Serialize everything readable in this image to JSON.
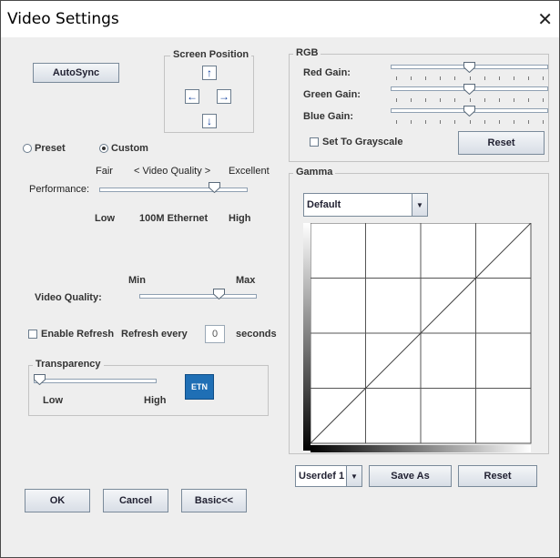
{
  "window": {
    "title": "Video Settings",
    "close_glyph": "✕"
  },
  "autosync_label": "AutoSync",
  "screen_position": {
    "title": "Screen Position",
    "up_icon": "arrow-up-icon",
    "left_icon": "arrow-left-icon",
    "right_icon": "arrow-right-icon",
    "down_icon": "arrow-down-icon"
  },
  "mode": {
    "preset_label": "Preset",
    "custom_label": "Custom",
    "selected": "Custom"
  },
  "performance": {
    "label": "Performance:",
    "top_left": "Fair",
    "top_center": "< Video Quality >",
    "top_right": "Excellent",
    "bottom_left": "Low",
    "bottom_center": "100M Ethernet",
    "bottom_right": "High",
    "value": 0.8
  },
  "video_quality": {
    "label": "Video Quality:",
    "min_label": "Min",
    "max_label": "Max",
    "value": 0.7
  },
  "refresh": {
    "enable_label": "Enable Refresh",
    "every_label": "Refresh every",
    "value": "0",
    "unit": "seconds"
  },
  "transparency": {
    "title": "Transparency",
    "low_label": "Low",
    "high_label": "High",
    "value": 0.0
  },
  "logo_text": "ETN",
  "buttons": {
    "ok": "OK",
    "cancel": "Cancel",
    "basic": "Basic<<"
  },
  "rgb": {
    "title": "RGB",
    "red_label": "Red Gain:",
    "green_label": "Green Gain:",
    "blue_label": "Blue Gain:",
    "red_value": 0.5,
    "green_value": 0.5,
    "blue_value": 0.5,
    "grayscale_label": "Set To Grayscale",
    "reset_label": "Reset"
  },
  "gamma": {
    "title": "Gamma",
    "preset_value": "Default",
    "userdef_value": "Userdef 1",
    "save_as_label": "Save As",
    "reset_label": "Reset"
  }
}
